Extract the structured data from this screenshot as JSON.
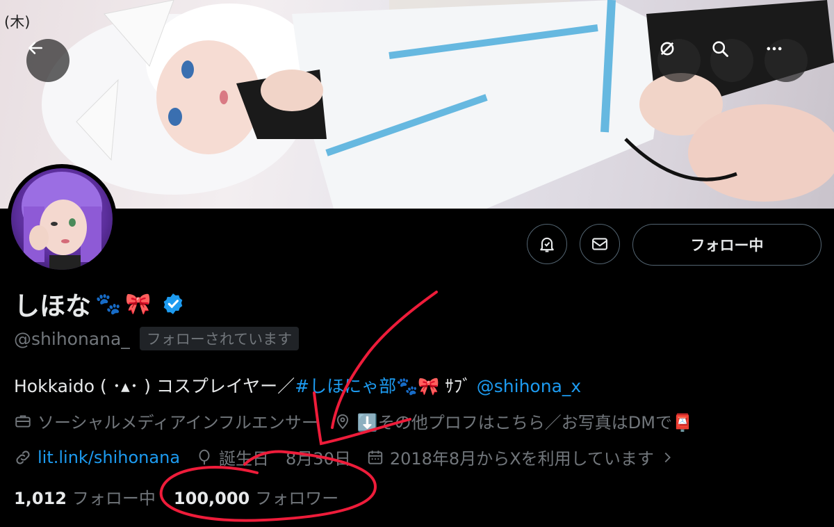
{
  "status": {
    "day": "(木)"
  },
  "header_buttons": {
    "back": "arrow-left-icon",
    "grok": "grok-icon",
    "search": "search-icon",
    "more": "more-icon"
  },
  "profile": {
    "name": "しほな",
    "name_emojis": [
      "🐾",
      "🎀"
    ],
    "verified": true,
    "handle": "@shihonana_",
    "follows_you": "フォローされています",
    "bio": {
      "text1": "Hokkaido ( ･▴･ ) コスプレイヤー／",
      "hashtag": "#しほにゃ部",
      "emojis": "🐾🎀",
      "sub_label": " ｻﾌﾞ ",
      "sub_account": "@shihona_x"
    },
    "category": "ソーシャルメディアインフルエンサー",
    "location": "⬇️その他プロフはこちら／お写真はDMで📮",
    "website": "lit.link/shihonana",
    "birthday": "誕生日　8月30日",
    "joined": "2018年8月からXを利用しています",
    "following_count": "1,012",
    "following_label": "フォロー中",
    "followers_count": "100,000",
    "followers_label": "フォロワー"
  },
  "actions": {
    "follow_button": "フォロー中"
  },
  "colors": {
    "accent": "#1d9bf0",
    "muted": "#71767b",
    "text": "#e7e9ea",
    "annotation": "#ee1c3a"
  }
}
